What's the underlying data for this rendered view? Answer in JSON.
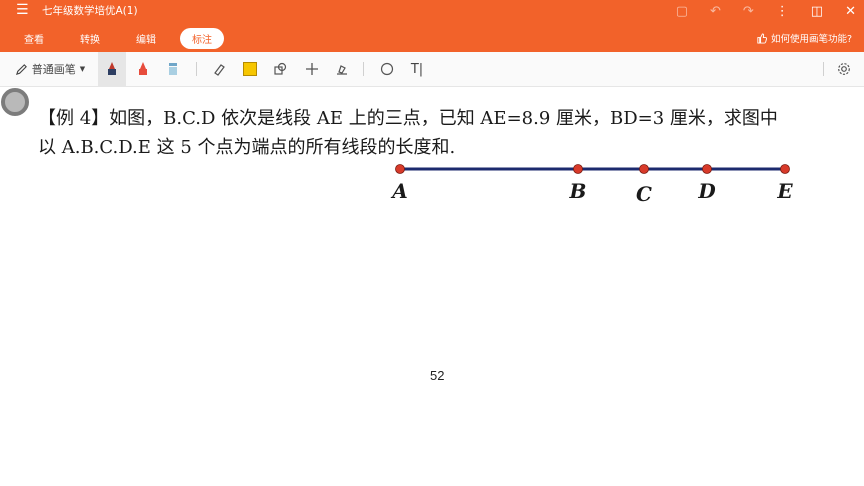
{
  "title_bar": {
    "menu_icon": "hamburger-icon",
    "doc_title": "七年级数学培优A(1)",
    "window_buttons": [
      "bookmark-icon",
      "undo-icon",
      "redo-icon",
      "more-icon",
      "page-icon",
      "close-icon"
    ]
  },
  "tabs": [
    {
      "label": "查看",
      "active": false
    },
    {
      "label": "转换",
      "active": false
    },
    {
      "label": "编辑",
      "active": false
    },
    {
      "label": "标注",
      "active": true
    }
  ],
  "help_link": "如何使用画笔功能?",
  "toolbar": {
    "pen_type": "普通画笔",
    "tools": [
      "pen-dark-icon",
      "pen-red-icon",
      "highlighter-icon",
      "eraser-icon",
      "color-swatch-icon",
      "shape-icon",
      "cross-icon",
      "stamp-icon",
      "circle-icon",
      "text-icon",
      "settings-icon"
    ],
    "swatch_color": "#f6c600"
  },
  "problem": {
    "line1": "【例 4】如图，B.C.D 依次是线段 AE 上的三点，已知 AE=8.9 厘米，BD=3 厘米，求图中",
    "line2": "以 A.B.C.D.E 这 5 个点为端点的所有线段的长度和."
  },
  "diagram": {
    "points": [
      "A",
      "B",
      "C",
      "D",
      "E"
    ],
    "line_color": "#1c2a6e",
    "point_color": "#d83a2a"
  },
  "page_number": "52",
  "colors": {
    "accent": "#f2622a"
  }
}
